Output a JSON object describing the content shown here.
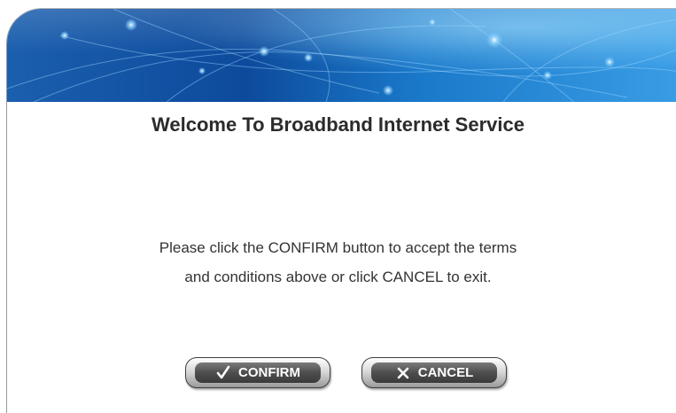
{
  "page": {
    "title": "Welcome To Broadband Internet Service",
    "message_lines": [
      "Please click the CONFIRM button to accept the terms",
      "and conditions above or click CANCEL to exit."
    ]
  },
  "buttons": {
    "confirm": {
      "label": "CONFIRM",
      "icon": "checkmark-icon"
    },
    "cancel": {
      "label": "CANCEL",
      "icon": "x-icon"
    }
  },
  "colors": {
    "banner_dark": "#0a4ea8",
    "banner_light": "#5fb6ef",
    "title_text": "#2b2b2b",
    "body_text": "#333333",
    "button_face": "#4e4e4e"
  }
}
